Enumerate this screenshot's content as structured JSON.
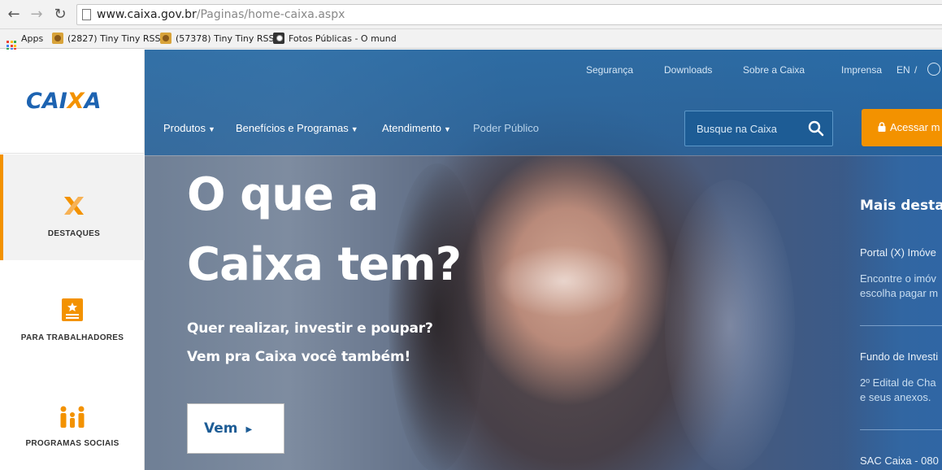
{
  "browser": {
    "url_host": "www.caixa.gov.br",
    "url_path": "/Paginas/home-caixa.aspx",
    "bookmarks": [
      {
        "label": "Apps",
        "icon": "apps-grid-icon"
      },
      {
        "label": "(2827) Tiny Tiny RSS",
        "icon": "rss-icon"
      },
      {
        "label": "(57378) Tiny Tiny RSS",
        "icon": "rss-icon"
      },
      {
        "label": "Fotos Públicas - O mund",
        "icon": "camera-icon"
      }
    ]
  },
  "sidebar": {
    "logo_prefix": "CAI",
    "logo_x": "X",
    "logo_suffix": "A",
    "items": [
      {
        "label": "DESTAQUES",
        "icon": "x-logo-icon",
        "active": true
      },
      {
        "label": "PARA TRABALHADORES",
        "icon": "document-icon",
        "active": false
      },
      {
        "label": "PROGRAMAS SOCIAIS",
        "icon": "family-icon",
        "active": false
      }
    ]
  },
  "header": {
    "util_links": [
      "Segurança",
      "Downloads",
      "Sobre a Caixa",
      "Imprensa",
      "EN"
    ],
    "util_sep": "/",
    "nav": [
      "Produtos",
      "Benefícios e Programas",
      "Atendimento",
      "Poder Público"
    ],
    "search_placeholder": "Busque na Caixa",
    "access_label": "Acessar m"
  },
  "hero": {
    "headline_line1": "O que a",
    "headline_line2": "Caixa tem?",
    "sub1": "Quer realizar, investir e poupar?",
    "sub2": "Vem pra Caixa você também!",
    "cta": "Vem"
  },
  "highlights": {
    "title": "Mais destac",
    "items": [
      {
        "title": "Portal (X) Imóve",
        "text1": "Encontre o imóv",
        "text2": "escolha pagar m"
      },
      {
        "title": "Fundo de Investi",
        "text1": "2º Edital de Cha",
        "text2": "e seus anexos."
      },
      {
        "title": "SAC Caixa - 080"
      }
    ]
  },
  "colors": {
    "brand_blue": "#1d63b1",
    "brand_orange": "#f39200",
    "header_blue": "#2a6eaa"
  }
}
